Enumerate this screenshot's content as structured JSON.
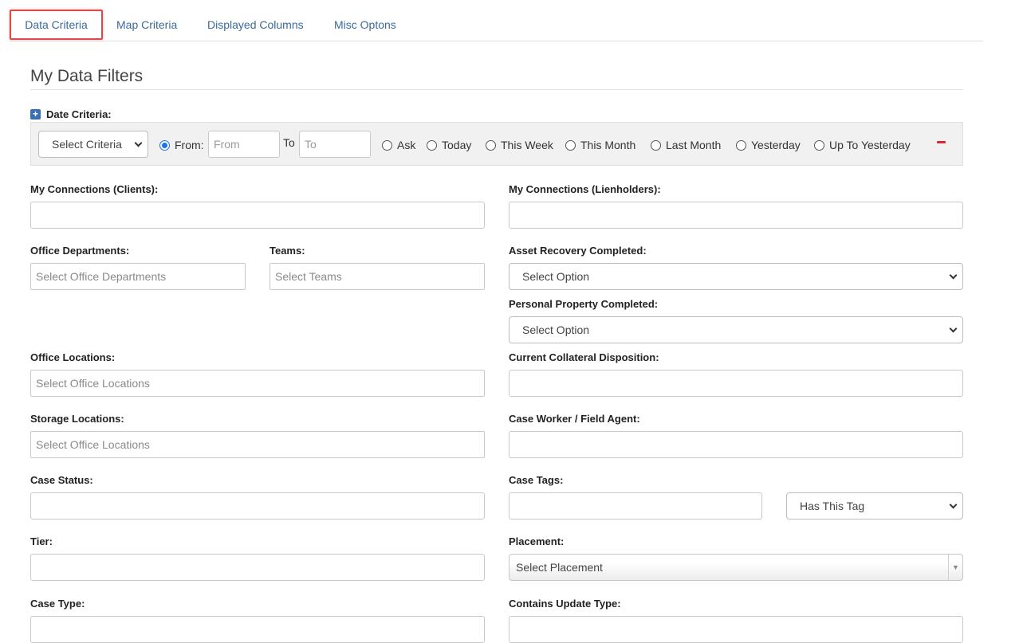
{
  "tabs": [
    "Data Criteria",
    "Map Criteria",
    "Displayed Columns",
    "Misc Optons"
  ],
  "section_title": "My Data Filters",
  "date_criteria": {
    "label": "Date Criteria:",
    "select_value": "Select Criteria",
    "from_label": "From:",
    "from_placeholder": "From",
    "to_label": "To",
    "to_placeholder": "To",
    "options": [
      "Ask",
      "Today",
      "This Week",
      "This Month",
      "Last Month",
      "Yesterday",
      "Up To Yesterday"
    ]
  },
  "fields": {
    "connections_clients": "My Connections (Clients):",
    "connections_lienholders": "My Connections (Lienholders):",
    "office_departments": "Office Departments:",
    "office_departments_ph": "Select Office Departments",
    "teams": "Teams:",
    "teams_ph": "Select Teams",
    "asset_recovery": "Asset Recovery Completed:",
    "asset_recovery_value": "Select Option",
    "personal_property": "Personal Property Completed:",
    "personal_property_value": "Select Option",
    "office_locations": "Office Locations:",
    "office_locations_ph": "Select Office Locations",
    "collateral_disposition": "Current Collateral Disposition:",
    "storage_locations": "Storage Locations:",
    "storage_locations_ph": "Select Office Locations",
    "case_worker": "Case Worker / Field Agent:",
    "case_status": "Case Status:",
    "case_tags": "Case Tags:",
    "tag_mode_value": "Has This Tag",
    "tier": "Tier:",
    "placement": "Placement:",
    "placement_value": "Select Placement",
    "case_type": "Case Type:",
    "update_type": "Contains Update Type:"
  }
}
